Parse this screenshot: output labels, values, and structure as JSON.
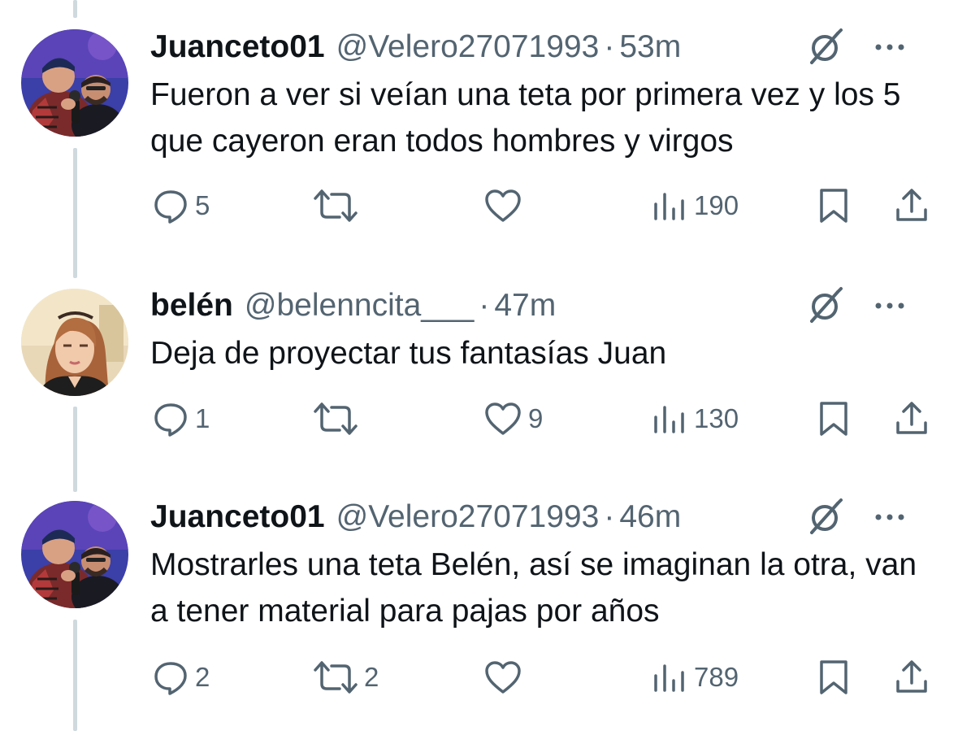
{
  "colors": {
    "text_primary": "#0f1419",
    "text_secondary": "#536471",
    "thread_line": "#cfd9de",
    "background": "#ffffff"
  },
  "tweets": [
    {
      "display_name": "Juanceto01",
      "handle": "@Velero27071993",
      "separator": "·",
      "time": "53m",
      "text": "Fueron a ver si veían una teta por primera vez y los 5 que cayeron eran todos hombres y virgos",
      "avatar_icon": "avatar-photo",
      "replies": "5",
      "reposts": "",
      "likes": "",
      "views": "190"
    },
    {
      "display_name": "belén",
      "handle": "@belenncita___",
      "separator": "·",
      "time": "47m",
      "text": "Deja de proyectar tus fantasías Juan",
      "avatar_icon": "avatar-photo",
      "replies": "1",
      "reposts": "",
      "likes": "9",
      "views": "130"
    },
    {
      "display_name": "Juanceto01",
      "handle": "@Velero27071993",
      "separator": "·",
      "time": "46m",
      "text": "Mostrarles una teta Belén, así se imaginan la otra, van a tener material para pajas por años",
      "avatar_icon": "avatar-photo",
      "replies": "2",
      "reposts": "2",
      "likes": "",
      "views": "789"
    }
  ],
  "icons": {
    "reply": "reply-icon",
    "repost": "repost-icon",
    "like": "heart-icon",
    "views": "views-icon",
    "bookmark": "bookmark-icon",
    "share": "share-icon",
    "grok": "grok-icon",
    "more": "more-icon"
  }
}
